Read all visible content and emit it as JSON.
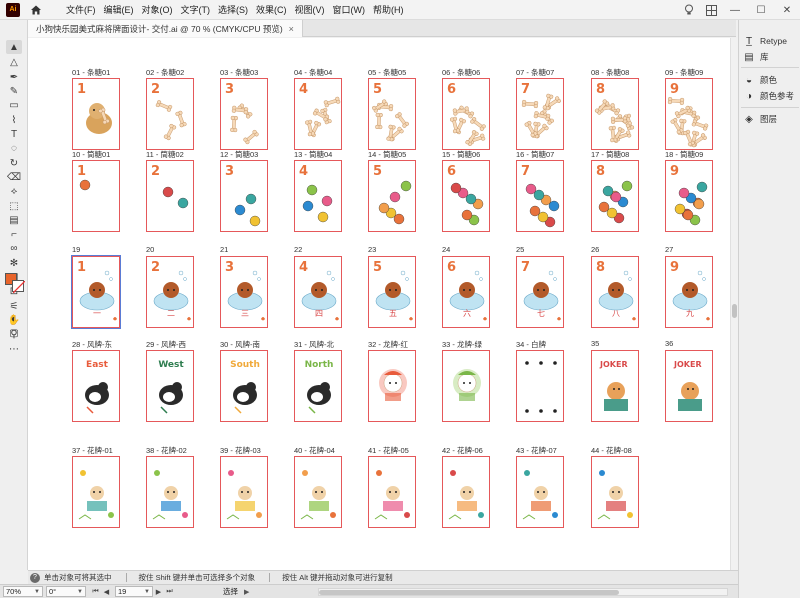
{
  "menubar": {
    "app_logo": "Ai",
    "items": [
      "文件(F)",
      "编辑(E)",
      "对象(O)",
      "文字(T)",
      "选择(S)",
      "效果(C)",
      "视图(V)",
      "窗口(W)",
      "帮助(H)"
    ],
    "right_icons": [
      "lightbulb-icon",
      "layout-grid-icon"
    ]
  },
  "document_tab": {
    "title": "小狗快乐园美式麻将牌面设计- 交付.ai @ 70 % (CMYK/CPU 预览)",
    "close": "×"
  },
  "tools": [
    {
      "name": "selection-tool-icon",
      "glyph": "▲"
    },
    {
      "name": "direct-selection-icon",
      "glyph": "△"
    },
    {
      "name": "pen-tool-icon",
      "glyph": "✒"
    },
    {
      "name": "curvature-tool-icon",
      "glyph": "✎"
    },
    {
      "name": "rectangle-tool-icon",
      "glyph": "▭"
    },
    {
      "name": "paintbrush-icon",
      "glyph": "⌇"
    },
    {
      "name": "type-tool-icon",
      "glyph": "T"
    },
    {
      "name": "lasso-icon",
      "glyph": "◌"
    },
    {
      "name": "rotate-tool-icon",
      "glyph": "↻"
    },
    {
      "name": "eraser-icon",
      "glyph": "⌫"
    },
    {
      "name": "width-tool-icon",
      "glyph": "⟡"
    },
    {
      "name": "free-transform-icon",
      "glyph": "⬚"
    },
    {
      "name": "gradient-tool-icon",
      "glyph": "▤"
    },
    {
      "name": "eyedropper-icon",
      "glyph": "⌐"
    },
    {
      "name": "blend-tool-icon",
      "glyph": "∞"
    },
    {
      "name": "symbol-sprayer-icon",
      "glyph": "✻"
    },
    {
      "name": "column-graph-icon",
      "glyph": "▥"
    },
    {
      "name": "artboard-tool-icon",
      "glyph": "⊡"
    },
    {
      "name": "slice-tool-icon",
      "glyph": "⚟"
    },
    {
      "name": "hand-tool-icon",
      "glyph": "✋"
    },
    {
      "name": "zoom-tool-icon",
      "glyph": "⚲"
    }
  ],
  "colors": {
    "fill": "#e8642b",
    "stroke": "#ffffff",
    "accent_orange": "#e8723b",
    "card_border": "#e5585a"
  },
  "panel": {
    "items": [
      {
        "label": "Retype",
        "icon": "retype-icon"
      },
      {
        "label": "库",
        "icon": "libraries-icon"
      },
      {
        "label": "颜色",
        "icon": "color-icon"
      },
      {
        "label": "颜色参考",
        "icon": "color-guide-icon"
      },
      {
        "label": "图层",
        "icon": "layers-icon"
      }
    ]
  },
  "cards": [
    [
      {
        "label": "01 - 条糖01",
        "num": "1",
        "art": "bone-dog"
      },
      {
        "label": "02 - 条糖02",
        "num": "2",
        "art": "bones"
      },
      {
        "label": "03 - 条糖03",
        "num": "3",
        "art": "bones"
      },
      {
        "label": "04 - 条糖04",
        "num": "4",
        "art": "bones"
      },
      {
        "label": "05 - 条糖05",
        "num": "5",
        "art": "bones"
      },
      {
        "label": "06 - 条糖06",
        "num": "6",
        "art": "bones"
      },
      {
        "label": "07 - 条糖07",
        "num": "7",
        "art": "bones"
      },
      {
        "label": "08 - 条糖08",
        "num": "8",
        "art": "bones"
      },
      {
        "label": "09 - 条糖09",
        "num": "9",
        "art": "bones"
      }
    ],
    [
      {
        "label": "10 - 筒糖01",
        "num": "1",
        "art": "balls"
      },
      {
        "label": "11 - 筒糖02",
        "num": "2",
        "art": "balls"
      },
      {
        "label": "12 - 筒糖03",
        "num": "3",
        "art": "balls"
      },
      {
        "label": "13 - 筒糖04",
        "num": "4",
        "art": "balls"
      },
      {
        "label": "14 - 筒糖05",
        "num": "5",
        "art": "balls"
      },
      {
        "label": "15 - 筒糖06",
        "num": "6",
        "art": "balls"
      },
      {
        "label": "16 - 筒糖07",
        "num": "7",
        "art": "balls"
      },
      {
        "label": "17 - 筒糖08",
        "num": "8",
        "art": "balls"
      },
      {
        "label": "18 - 筒糖09",
        "num": "9",
        "art": "balls"
      }
    ],
    [
      {
        "label": "19",
        "num": "1",
        "art": "bath",
        "char": "一"
      },
      {
        "label": "20",
        "num": "2",
        "art": "bath",
        "char": "二"
      },
      {
        "label": "21",
        "num": "3",
        "art": "bath",
        "char": "三"
      },
      {
        "label": "22",
        "num": "4",
        "art": "bath",
        "char": "四"
      },
      {
        "label": "23",
        "num": "5",
        "art": "bath",
        "char": "五"
      },
      {
        "label": "24",
        "num": "6",
        "art": "bath",
        "char": "六"
      },
      {
        "label": "25",
        "num": "7",
        "art": "bath",
        "char": "七"
      },
      {
        "label": "26",
        "num": "8",
        "art": "bath",
        "char": "八"
      },
      {
        "label": "27",
        "num": "9",
        "art": "bath",
        "char": "九"
      }
    ],
    [
      {
        "label": "28 - 风牌-东",
        "num": "",
        "art": "wind",
        "word": "East"
      },
      {
        "label": "29 - 风牌-西",
        "num": "",
        "art": "wind",
        "word": "West"
      },
      {
        "label": "30 - 风牌-南",
        "num": "",
        "art": "wind",
        "word": "South"
      },
      {
        "label": "31 - 风牌-北",
        "num": "",
        "art": "wind",
        "word": "North"
      },
      {
        "label": "32 - 龙牌-红",
        "num": "",
        "art": "dragon-red"
      },
      {
        "label": "33 - 龙牌-绿",
        "num": "",
        "art": "dragon-green"
      },
      {
        "label": "34 - 白牌",
        "num": "",
        "art": "white"
      },
      {
        "label": "35",
        "num": "",
        "art": "joker",
        "word": "JOKER"
      },
      {
        "label": "36",
        "num": "",
        "art": "joker",
        "word": "JOKER"
      }
    ],
    [
      {
        "label": "37 - 花牌-01",
        "num": "",
        "art": "flower"
      },
      {
        "label": "38 - 花牌-02",
        "num": "",
        "art": "flower"
      },
      {
        "label": "39 - 花牌-03",
        "num": "",
        "art": "flower"
      },
      {
        "label": "40 - 花牌-04",
        "num": "",
        "art": "flower"
      },
      {
        "label": "41 - 花牌-05",
        "num": "",
        "art": "flower"
      },
      {
        "label": "42 - 花牌-06",
        "num": "",
        "art": "flower"
      },
      {
        "label": "43 - 花牌-07",
        "num": "",
        "art": "flower"
      },
      {
        "label": "44 - 花牌-08",
        "num": "",
        "art": "flower"
      }
    ]
  ],
  "hintbar": {
    "help": "?",
    "hint1": "单击对象可将其选中",
    "hint2": "按住 Shift 键并单击可选择多个对象",
    "hint3": "按住 Alt 键并拖动对象可进行复制"
  },
  "statusbar": {
    "zoom": "70%",
    "angle": "0°",
    "artboard": "19",
    "tool": "选择"
  }
}
